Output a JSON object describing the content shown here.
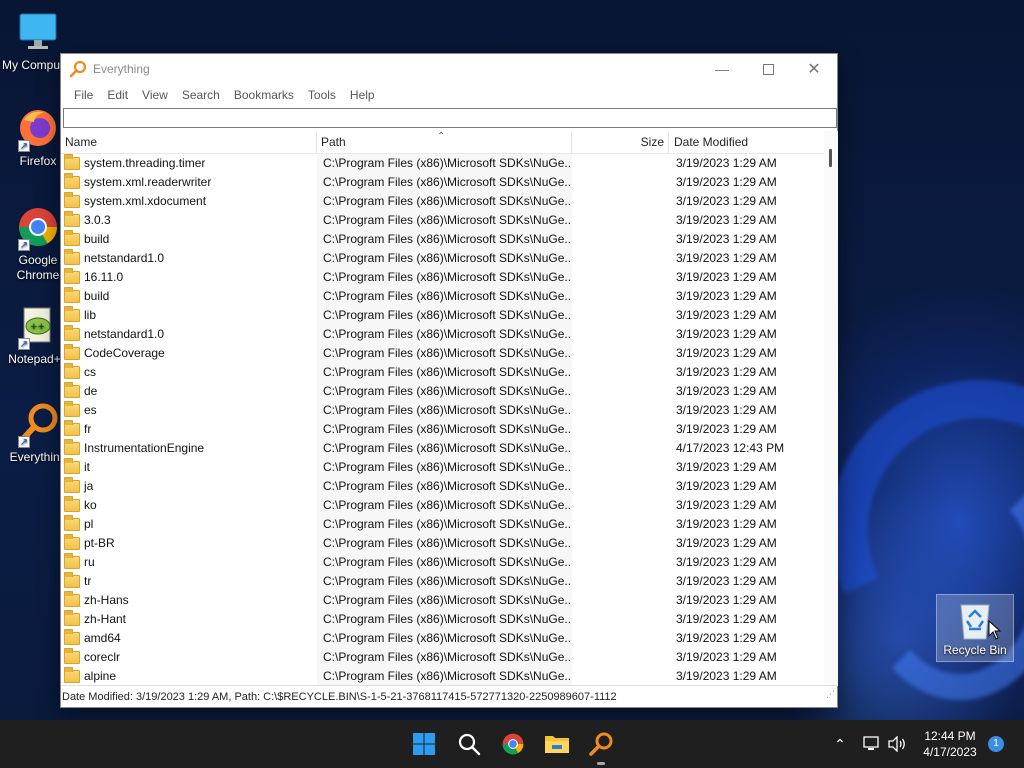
{
  "desktop": {
    "icons": [
      {
        "label": "My Computer",
        "icon": "monitor-icon"
      },
      {
        "label": "Firefox",
        "icon": "firefox-icon"
      },
      {
        "label": "Google Chrome",
        "icon": "chrome-icon"
      },
      {
        "label": "Notepad++",
        "icon": "notepad-plus-plus-icon"
      },
      {
        "label": "Everything",
        "icon": "everything-icon"
      },
      {
        "label": "Recycle Bin",
        "icon": "recycle-bin-icon"
      }
    ]
  },
  "window": {
    "title": "Everything",
    "menu": [
      "File",
      "Edit",
      "View",
      "Search",
      "Bookmarks",
      "Tools",
      "Help"
    ],
    "search_value": "",
    "columns": {
      "name": "Name",
      "path": "Path",
      "size": "Size",
      "date": "Date Modified"
    },
    "rows": [
      {
        "name": "system.threading.timer",
        "path": "C:\\Program Files (x86)\\Microsoft SDKs\\NuGe...",
        "size": "",
        "date": "3/19/2023 1:29 AM"
      },
      {
        "name": "system.xml.readerwriter",
        "path": "C:\\Program Files (x86)\\Microsoft SDKs\\NuGe...",
        "size": "",
        "date": "3/19/2023 1:29 AM"
      },
      {
        "name": "system.xml.xdocument",
        "path": "C:\\Program Files (x86)\\Microsoft SDKs\\NuGe...",
        "size": "",
        "date": "3/19/2023 1:29 AM"
      },
      {
        "name": "3.0.3",
        "path": "C:\\Program Files (x86)\\Microsoft SDKs\\NuGe...",
        "size": "",
        "date": "3/19/2023 1:29 AM"
      },
      {
        "name": "build",
        "path": "C:\\Program Files (x86)\\Microsoft SDKs\\NuGe...",
        "size": "",
        "date": "3/19/2023 1:29 AM"
      },
      {
        "name": "netstandard1.0",
        "path": "C:\\Program Files (x86)\\Microsoft SDKs\\NuGe...",
        "size": "",
        "date": "3/19/2023 1:29 AM"
      },
      {
        "name": "16.11.0",
        "path": "C:\\Program Files (x86)\\Microsoft SDKs\\NuGe...",
        "size": "",
        "date": "3/19/2023 1:29 AM"
      },
      {
        "name": "build",
        "path": "C:\\Program Files (x86)\\Microsoft SDKs\\NuGe...",
        "size": "",
        "date": "3/19/2023 1:29 AM"
      },
      {
        "name": "lib",
        "path": "C:\\Program Files (x86)\\Microsoft SDKs\\NuGe...",
        "size": "",
        "date": "3/19/2023 1:29 AM"
      },
      {
        "name": "netstandard1.0",
        "path": "C:\\Program Files (x86)\\Microsoft SDKs\\NuGe...",
        "size": "",
        "date": "3/19/2023 1:29 AM"
      },
      {
        "name": "CodeCoverage",
        "path": "C:\\Program Files (x86)\\Microsoft SDKs\\NuGe...",
        "size": "",
        "date": "3/19/2023 1:29 AM"
      },
      {
        "name": "cs",
        "path": "C:\\Program Files (x86)\\Microsoft SDKs\\NuGe...",
        "size": "",
        "date": "3/19/2023 1:29 AM"
      },
      {
        "name": "de",
        "path": "C:\\Program Files (x86)\\Microsoft SDKs\\NuGe...",
        "size": "",
        "date": "3/19/2023 1:29 AM"
      },
      {
        "name": "es",
        "path": "C:\\Program Files (x86)\\Microsoft SDKs\\NuGe...",
        "size": "",
        "date": "3/19/2023 1:29 AM"
      },
      {
        "name": "fr",
        "path": "C:\\Program Files (x86)\\Microsoft SDKs\\NuGe...",
        "size": "",
        "date": "3/19/2023 1:29 AM"
      },
      {
        "name": "InstrumentationEngine",
        "path": "C:\\Program Files (x86)\\Microsoft SDKs\\NuGe...",
        "size": "",
        "date": "4/17/2023 12:43 PM"
      },
      {
        "name": "it",
        "path": "C:\\Program Files (x86)\\Microsoft SDKs\\NuGe...",
        "size": "",
        "date": "3/19/2023 1:29 AM"
      },
      {
        "name": "ja",
        "path": "C:\\Program Files (x86)\\Microsoft SDKs\\NuGe...",
        "size": "",
        "date": "3/19/2023 1:29 AM"
      },
      {
        "name": "ko",
        "path": "C:\\Program Files (x86)\\Microsoft SDKs\\NuGe...",
        "size": "",
        "date": "3/19/2023 1:29 AM"
      },
      {
        "name": "pl",
        "path": "C:\\Program Files (x86)\\Microsoft SDKs\\NuGe...",
        "size": "",
        "date": "3/19/2023 1:29 AM"
      },
      {
        "name": "pt-BR",
        "path": "C:\\Program Files (x86)\\Microsoft SDKs\\NuGe...",
        "size": "",
        "date": "3/19/2023 1:29 AM"
      },
      {
        "name": "ru",
        "path": "C:\\Program Files (x86)\\Microsoft SDKs\\NuGe...",
        "size": "",
        "date": "3/19/2023 1:29 AM"
      },
      {
        "name": "tr",
        "path": "C:\\Program Files (x86)\\Microsoft SDKs\\NuGe...",
        "size": "",
        "date": "3/19/2023 1:29 AM"
      },
      {
        "name": "zh-Hans",
        "path": "C:\\Program Files (x86)\\Microsoft SDKs\\NuGe...",
        "size": "",
        "date": "3/19/2023 1:29 AM"
      },
      {
        "name": "zh-Hant",
        "path": "C:\\Program Files (x86)\\Microsoft SDKs\\NuGe...",
        "size": "",
        "date": "3/19/2023 1:29 AM"
      },
      {
        "name": "amd64",
        "path": "C:\\Program Files (x86)\\Microsoft SDKs\\NuGe...",
        "size": "",
        "date": "3/19/2023 1:29 AM"
      },
      {
        "name": "coreclr",
        "path": "C:\\Program Files (x86)\\Microsoft SDKs\\NuGe...",
        "size": "",
        "date": "3/19/2023 1:29 AM"
      },
      {
        "name": "alpine",
        "path": "C:\\Program Files (x86)\\Microsoft SDKs\\NuGe...",
        "size": "",
        "date": "3/19/2023 1:29 AM"
      }
    ],
    "status": "Date Modified: 3/19/2023 1:29 AM, Path: C:\\$RECYCLE.BIN\\S-1-5-21-3768117415-572771320-2250989607-1112"
  },
  "taskbar": {
    "items": [
      "start-icon",
      "search-icon",
      "chrome-icon",
      "file-explorer-icon",
      "everything-icon"
    ],
    "time": "12:44 PM",
    "date": "4/17/2023",
    "notification_count": "1"
  },
  "colors": {
    "accent": "#f08c1e",
    "taskbar": "#1f1f1f",
    "folder": "#f1c24a"
  }
}
